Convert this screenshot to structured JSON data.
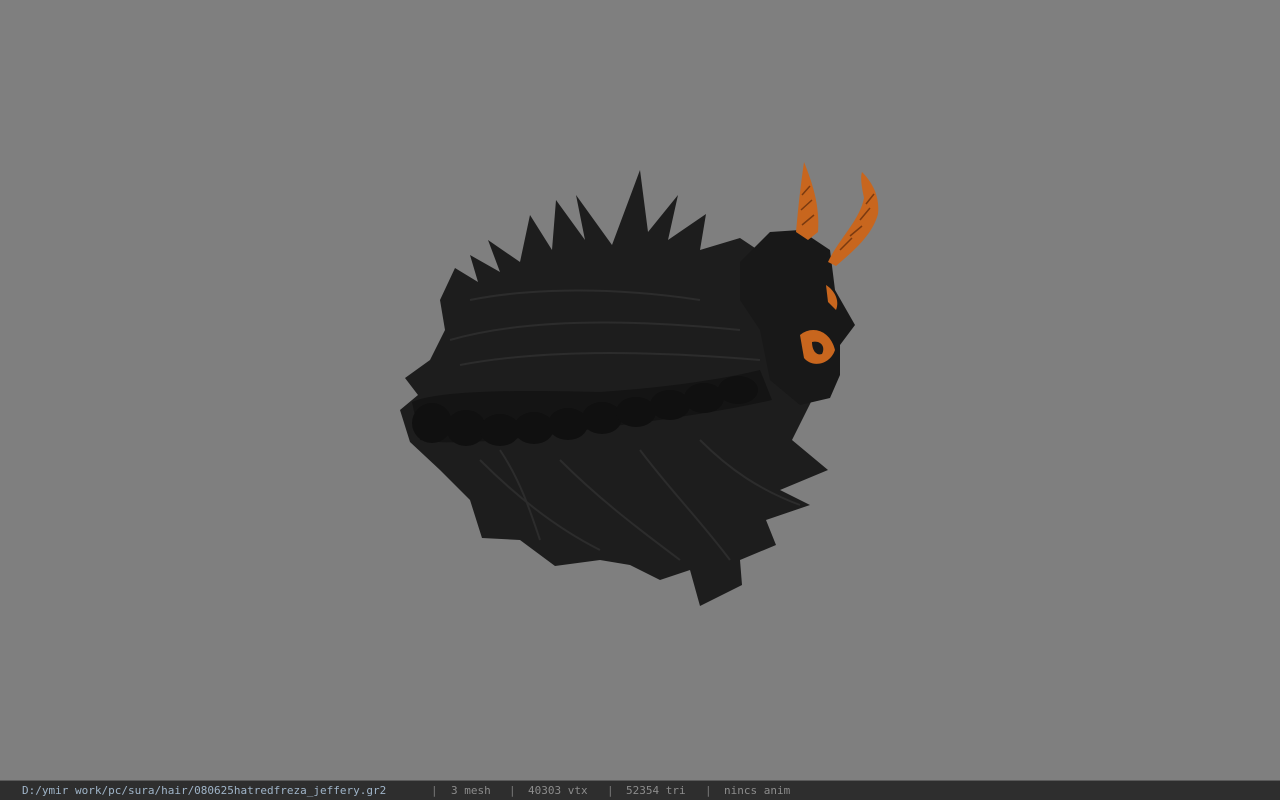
{
  "viewer": {
    "background_color": "#7f7f7f",
    "model_name": "hair-with-horns-model",
    "hair_color": "#1f1f1f",
    "horn_color": "#c8661e"
  },
  "statusbar": {
    "file_path": "D:/ymir work/pc/sura/hair/080625hatredfreza_jeffery.gr2",
    "separator": "|",
    "mesh": "3 mesh",
    "vtx": "40303 vtx",
    "tri": "52354 tri",
    "anim": "nincs anim"
  }
}
